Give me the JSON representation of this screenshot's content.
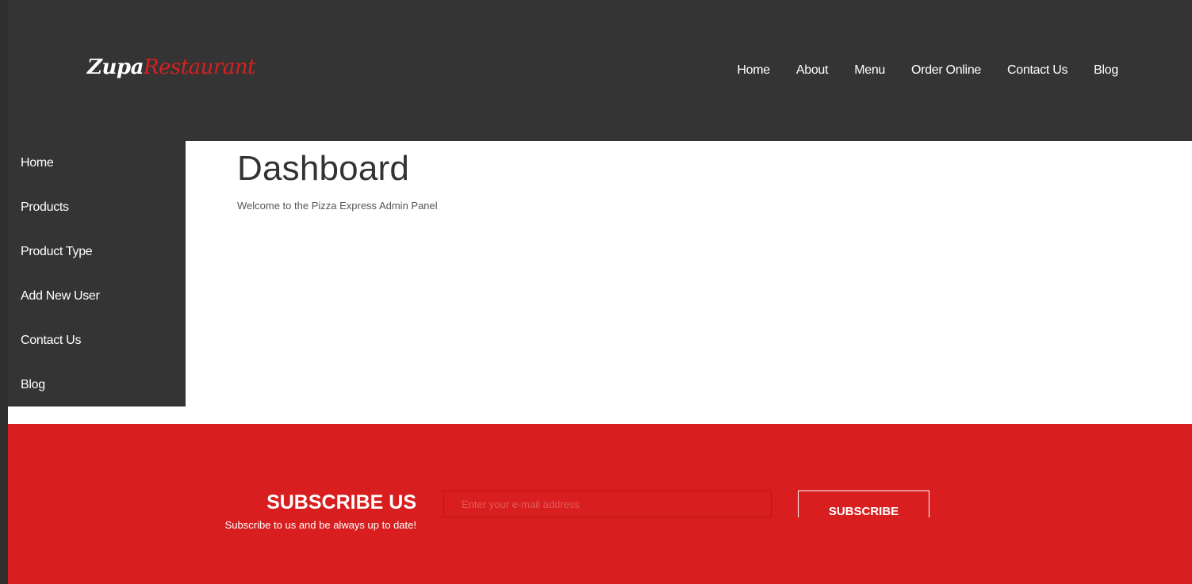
{
  "header": {
    "logo_part1": "Zupa",
    "logo_part2": "Restaurant",
    "nav": [
      "Home",
      "About",
      "Menu",
      "Order Online",
      "Contact Us",
      "Blog"
    ]
  },
  "sidebar": {
    "items": [
      "Home",
      "Products",
      "Product Type",
      "Add New User",
      "Contact Us",
      "Blog"
    ]
  },
  "main": {
    "title": "Dashboard",
    "subtitle": "Welcome to the Pizza Express Admin Panel"
  },
  "footer": {
    "title": "SUBSCRIBE US",
    "subtitle": "Subscribe to us and be always up to date!",
    "email_placeholder": "Enter your e-mail address",
    "button_label": "SUBSCRIBE"
  },
  "colors": {
    "header_bg": "#343434",
    "accent_red": "#d81e1e",
    "page_bg": "#ffffff"
  }
}
